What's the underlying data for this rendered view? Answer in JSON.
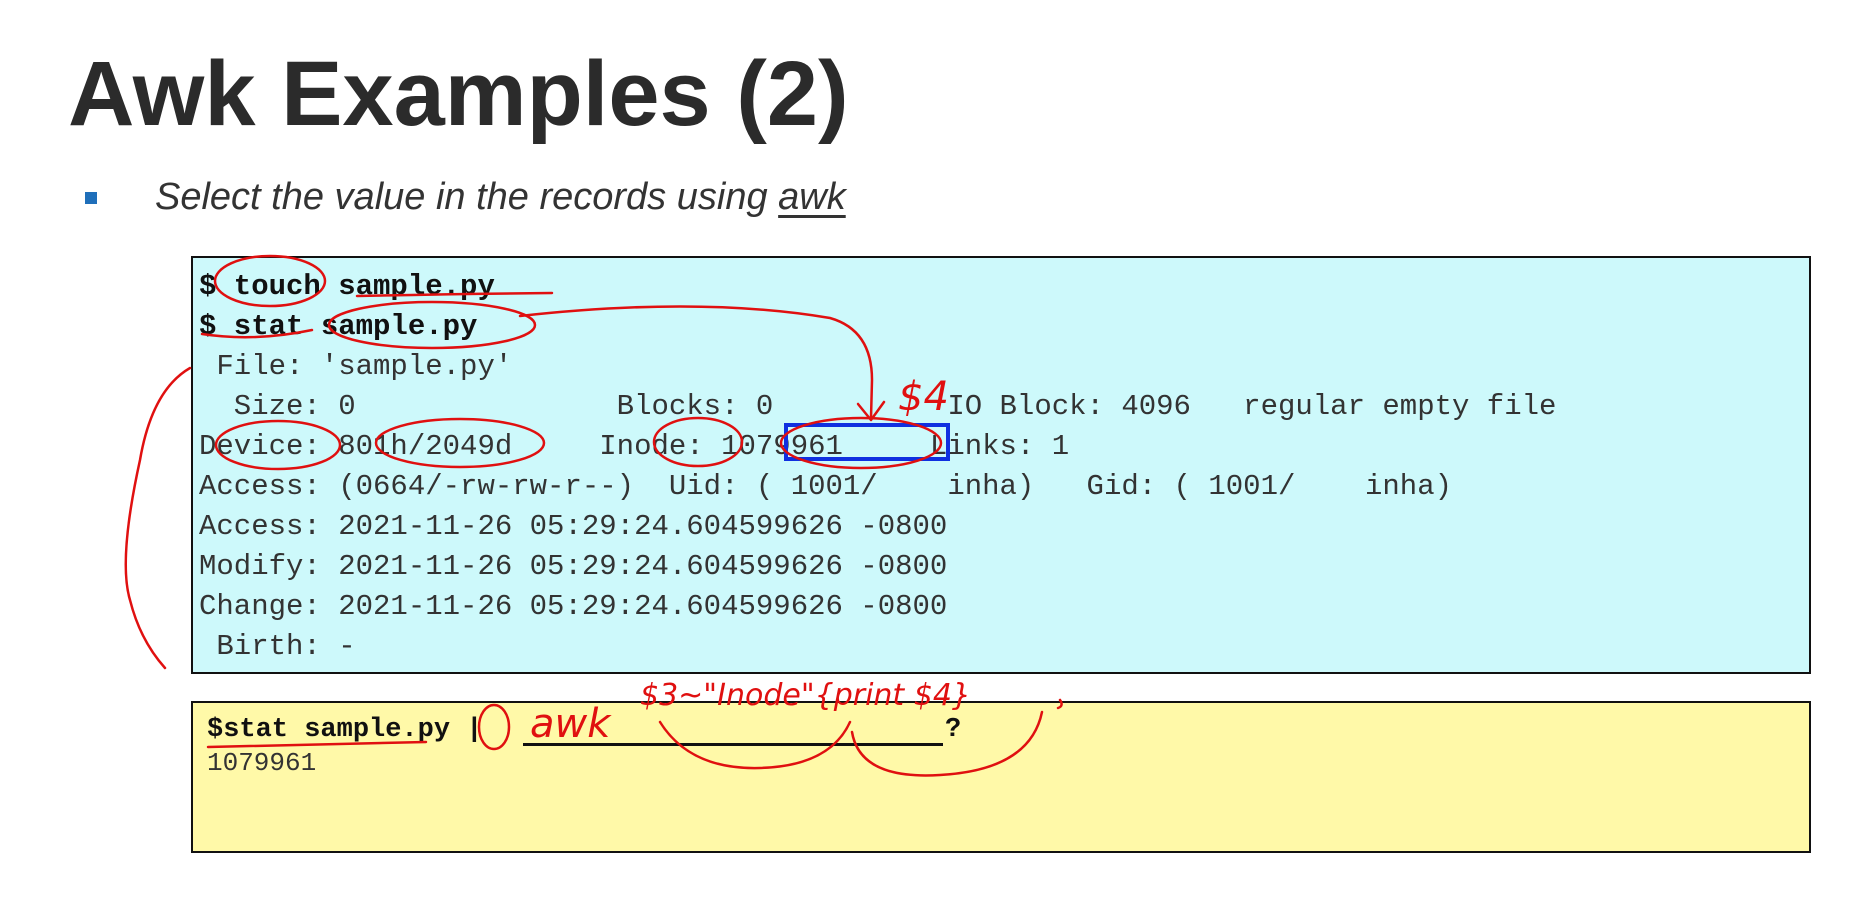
{
  "slide": {
    "title": "Awk Examples (2)",
    "bullet_prefix": "Select the value in the records using ",
    "bullet_awk": "awk"
  },
  "terminal": {
    "lines": [
      "$ touch sample.py",
      "$ stat sample.py",
      " File: 'sample.py'",
      "  Size: 0               Blocks: 0          IO Block: 4096   regular empty file",
      "Device: 801h/2049d     Inode: 1079961     Links: 1",
      "Access: (0664/-rw-rw-r--)  Uid: ( 1001/    inha)   Gid: ( 1001/    inha)",
      "Access: 2021-11-26 05:29:24.604599626 -0800",
      "Modify: 2021-11-26 05:29:24.604599626 -0800",
      "Change: 2021-11-26 05:29:24.604599626 -0800",
      " Birth: -"
    ]
  },
  "answer": {
    "command": "$stat sample.py |",
    "question_mark": "?",
    "output": "1079961"
  },
  "annotations": {
    "dollar_four": "$4",
    "awk": "awk",
    "pattern": "$3~\"Inode\"{print $4}"
  },
  "colors": {
    "terminal_bg": "#cdf9fb",
    "answer_bg": "#fff9a8",
    "bullet": "#1f6fba",
    "ink": "#e01010",
    "highlight_box": "#1030e0"
  }
}
